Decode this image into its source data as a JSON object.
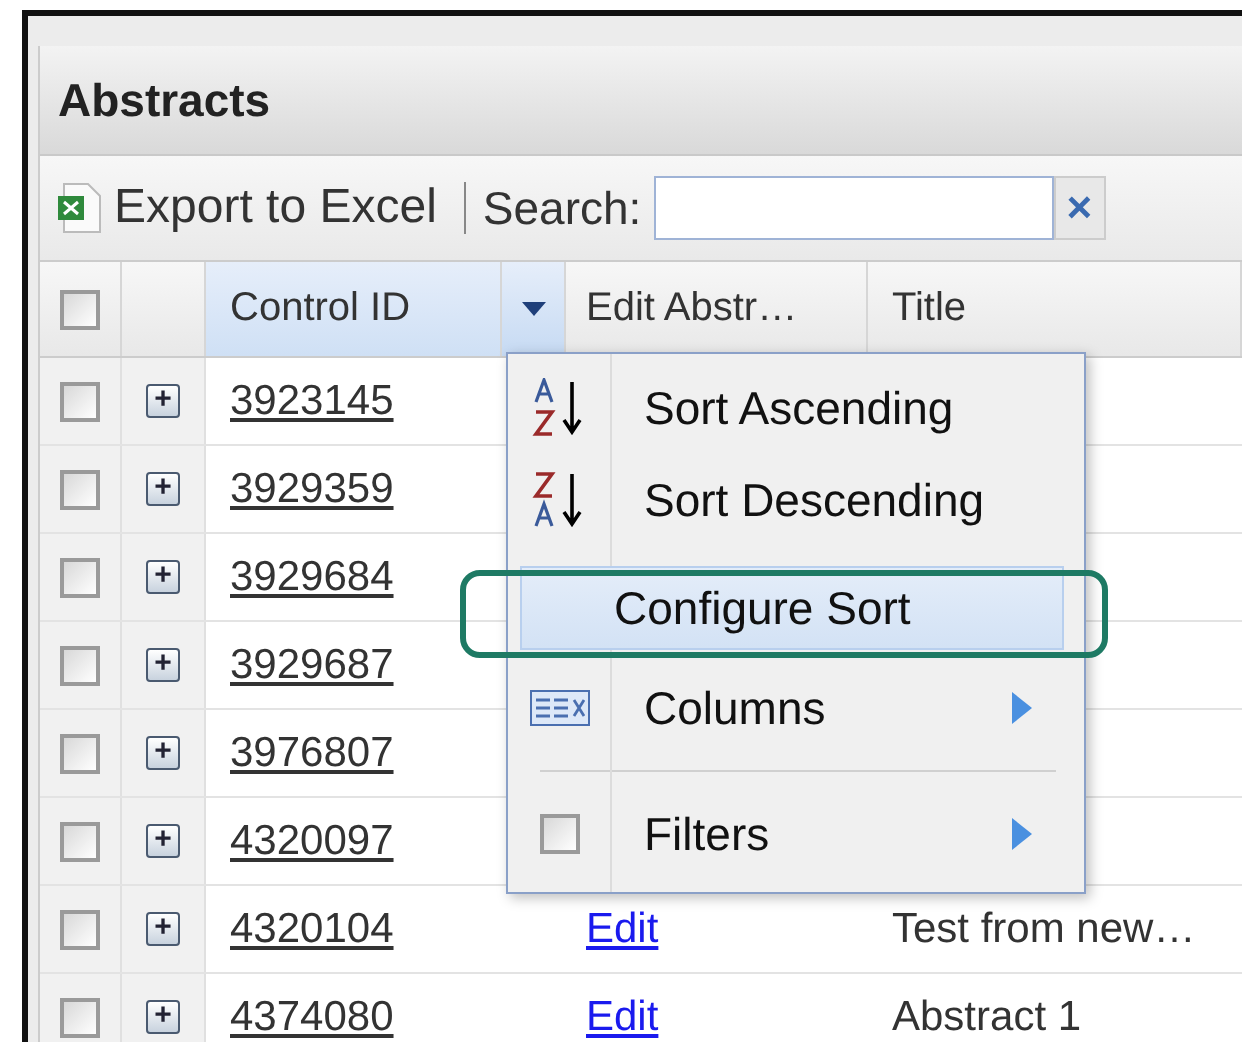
{
  "panel": {
    "title": "Abstracts"
  },
  "toolbar": {
    "export_label": "Export to Excel",
    "search_label": "Search:",
    "clear_label": "×"
  },
  "table": {
    "select_all": {
      "checked": false
    },
    "columns": [
      {
        "label": "Control ID",
        "sorted": true
      },
      {
        "label": "Edit Abstr…",
        "sorted": false
      },
      {
        "label": "Title",
        "sorted": false
      }
    ],
    "rows": [
      {
        "checked": false,
        "expander": "+",
        "control_id": "3923145"
      },
      {
        "checked": false,
        "expander": "+",
        "control_id": "3929359"
      },
      {
        "checked": false,
        "expander": "+",
        "control_id": "3929684"
      },
      {
        "checked": false,
        "expander": "+",
        "control_id": "3929687"
      },
      {
        "checked": false,
        "expander": "+",
        "control_id": "3976807"
      },
      {
        "checked": false,
        "expander": "+",
        "control_id": "4320097"
      },
      {
        "checked": false,
        "expander": "+",
        "control_id": "4320104",
        "edit": "Edit",
        "title": "Test from new…"
      },
      {
        "checked": false,
        "expander": "+",
        "control_id": "4374080",
        "edit": "Edit",
        "title": "Abstract 1"
      }
    ]
  },
  "column_menu": {
    "items": [
      {
        "kind": "sort-asc",
        "label": "Sort Ascending",
        "selected": false,
        "highlighted_outline": false
      },
      {
        "kind": "sort-desc",
        "label": "Sort Descending",
        "selected": false,
        "highlighted_outline": false
      },
      {
        "kind": "plain",
        "label": "Configure Sort",
        "selected": true,
        "highlighted_outline": true
      },
      {
        "kind": "columns",
        "label": "Columns",
        "selected": false,
        "highlighted_outline": false
      },
      {
        "kind": "separator"
      },
      {
        "kind": "filters",
        "label": "Filters",
        "selected": false,
        "highlighted_outline": false,
        "checked": false
      }
    ]
  }
}
